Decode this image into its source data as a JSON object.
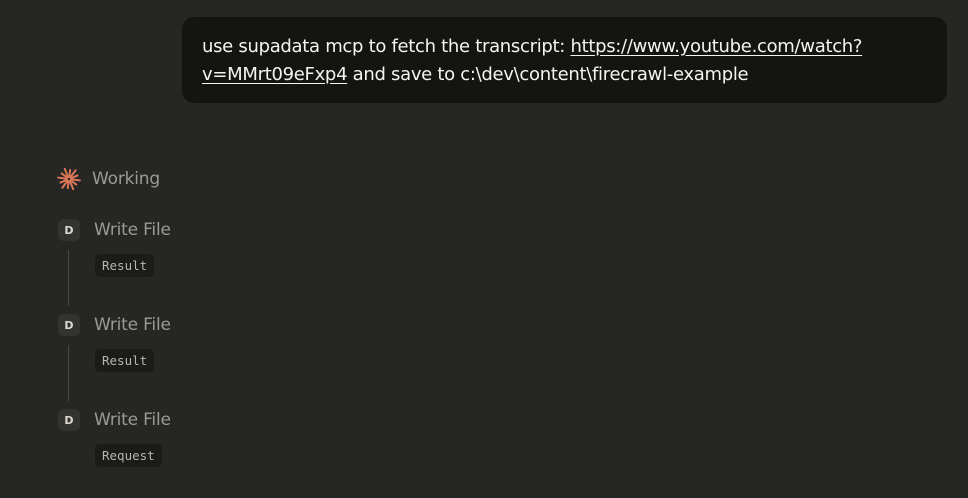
{
  "user_message": {
    "prefix": "use supadata mcp to fetch the transcript: ",
    "link_text": "https://www.youtube.com/watch?v=MMrt09eFxp4",
    "suffix": " and save to c:\\dev\\content\\firecrawl-example"
  },
  "status": {
    "icon": "spark-icon",
    "label": "Working",
    "accent_color": "#d97757"
  },
  "steps": [
    {
      "icon_letter": "D",
      "title": "Write File",
      "tag": "Result"
    },
    {
      "icon_letter": "D",
      "title": "Write File",
      "tag": "Result"
    },
    {
      "icon_letter": "D",
      "title": "Write File",
      "tag": "Request"
    }
  ]
}
